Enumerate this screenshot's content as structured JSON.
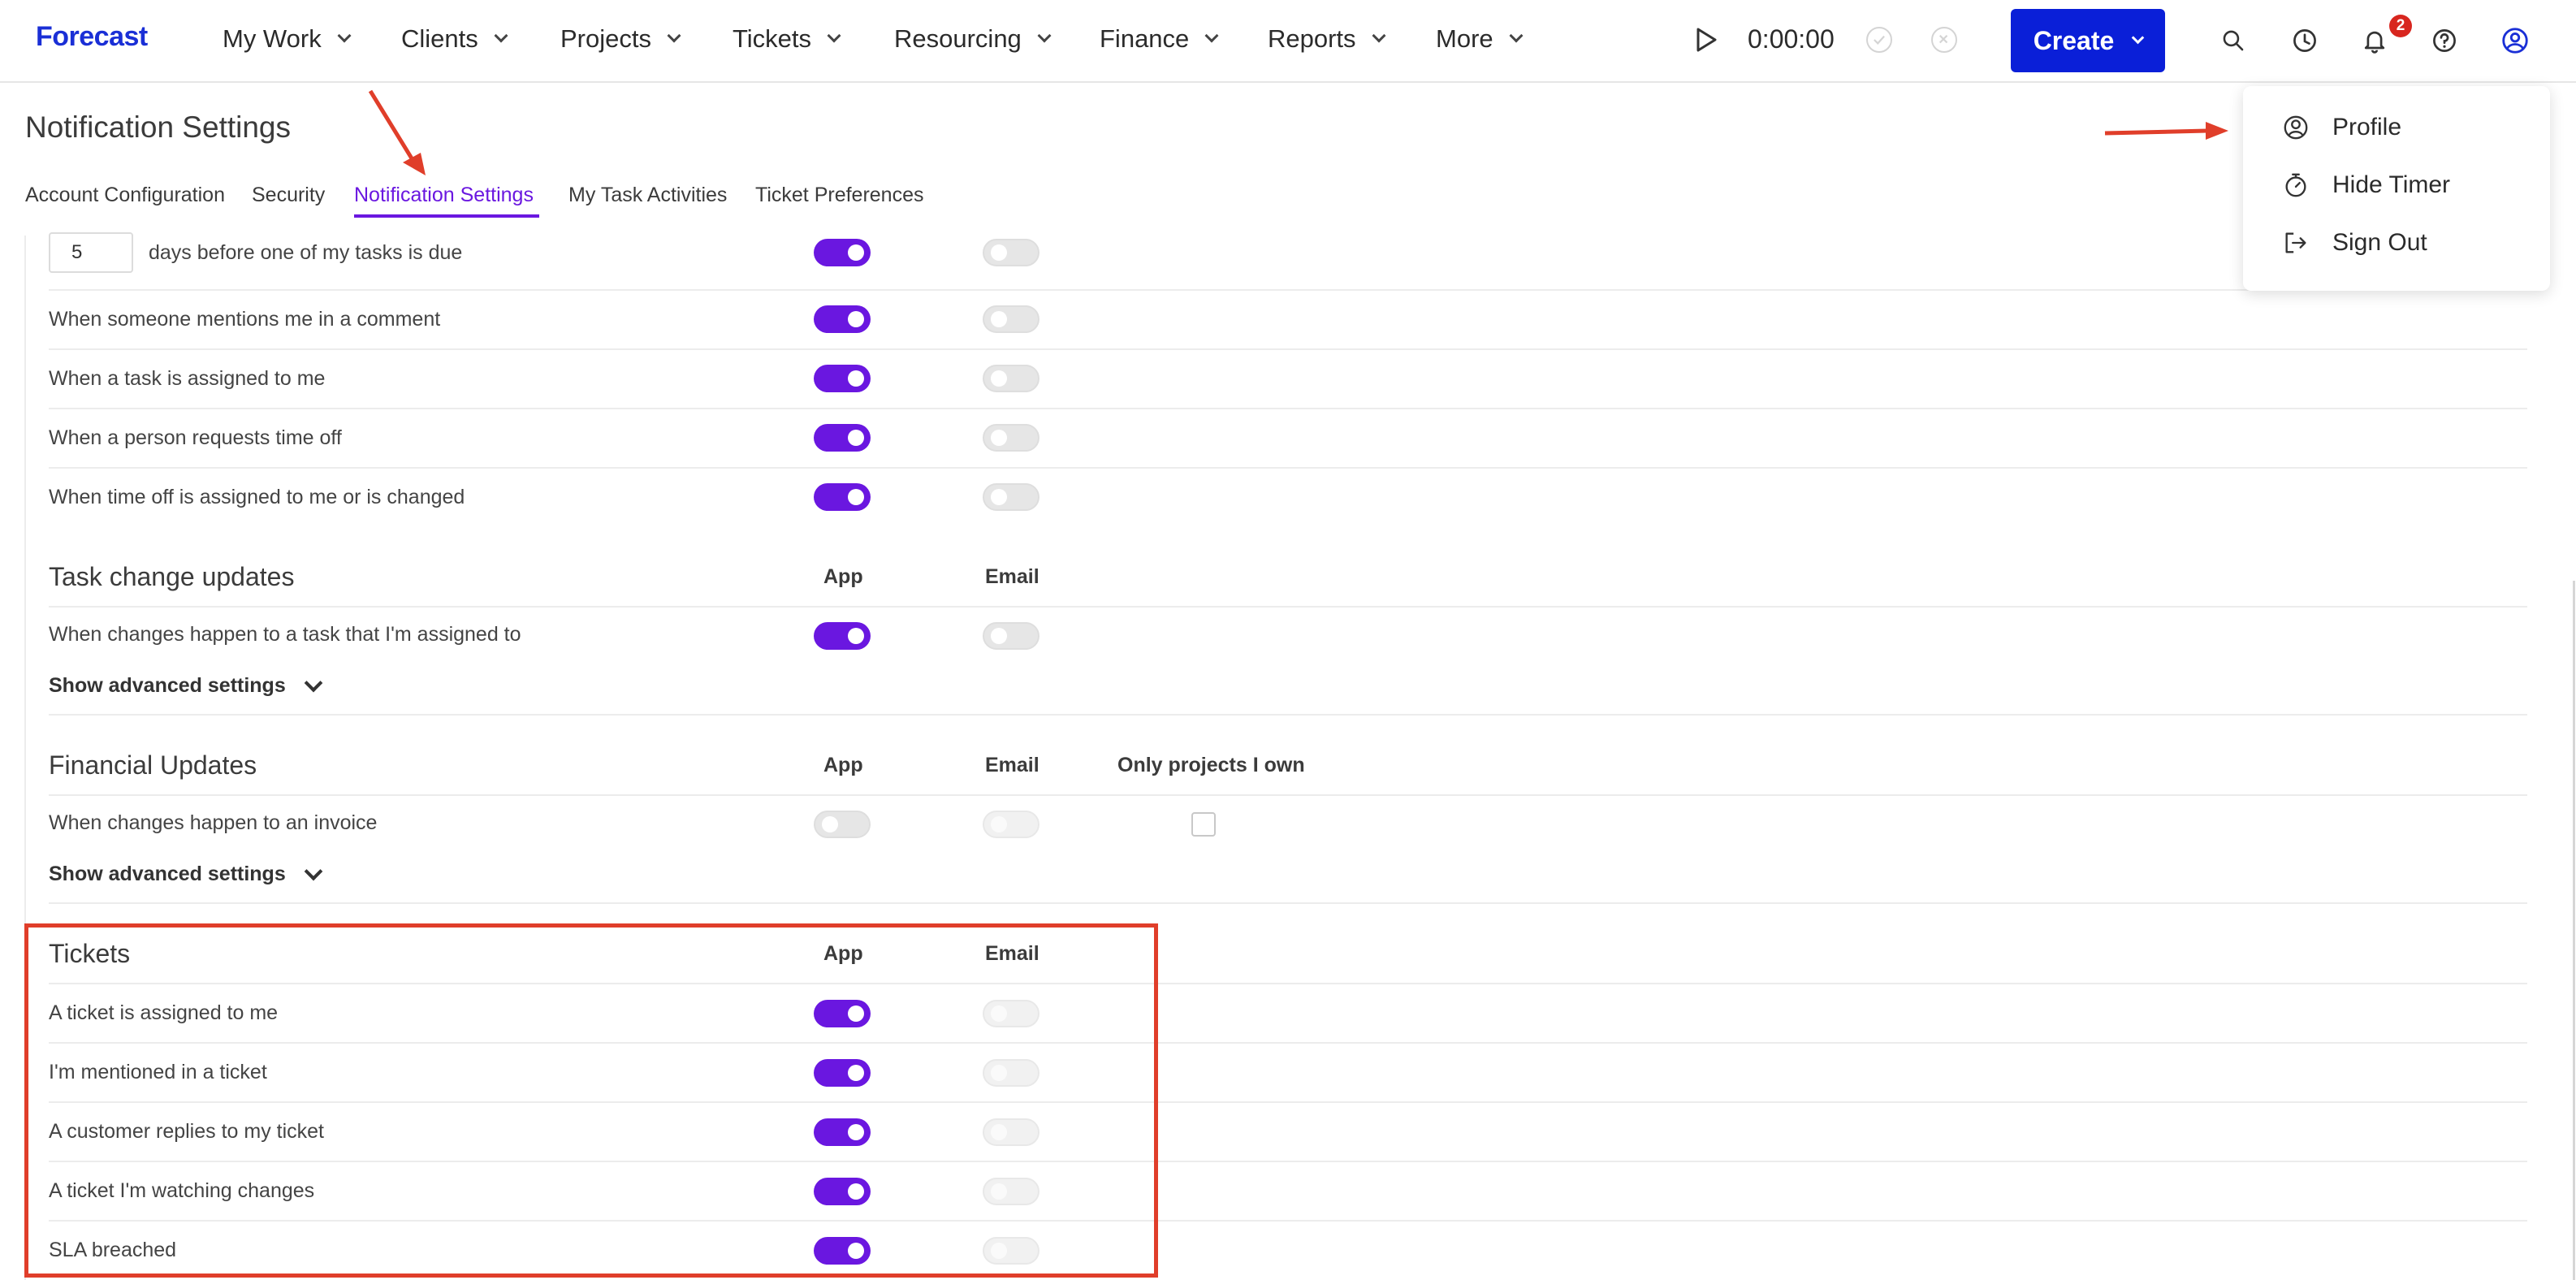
{
  "app": {
    "logo": "Forecast"
  },
  "nav": {
    "items": [
      {
        "label": "My Work"
      },
      {
        "label": "Clients"
      },
      {
        "label": "Projects"
      },
      {
        "label": "Tickets"
      },
      {
        "label": "Resourcing"
      },
      {
        "label": "Finance"
      },
      {
        "label": "Reports"
      },
      {
        "label": "More"
      }
    ],
    "timer": "0:00:00",
    "create_label": "Create",
    "notification_count": "2"
  },
  "page": {
    "title": "Notification Settings",
    "tabs": [
      {
        "label": "Account Configuration"
      },
      {
        "label": "Security"
      },
      {
        "label": "Notification Settings",
        "active": true
      },
      {
        "label": "My Task Activities"
      },
      {
        "label": "Ticket Preferences"
      }
    ]
  },
  "task_reminders": {
    "days_value": "5",
    "days_label": "days before one of my tasks is due",
    "rows": [
      {
        "label": "When someone mentions me in a comment",
        "app": true,
        "email": false
      },
      {
        "label": "When a task is assigned to me",
        "app": true,
        "email": false
      },
      {
        "label": "When a person requests time off",
        "app": true,
        "email": false
      },
      {
        "label": "When time off is assigned to me or is changed",
        "app": true,
        "email": false
      }
    ]
  },
  "task_change": {
    "title": "Task change updates",
    "col_app": "App",
    "col_email": "Email",
    "row": "When changes happen to a task that I'm assigned to",
    "advanced": "Show advanced settings"
  },
  "financial": {
    "title": "Financial Updates",
    "col_app": "App",
    "col_email": "Email",
    "col_own": "Only projects I own",
    "row": "When changes happen to an invoice",
    "advanced": "Show advanced settings"
  },
  "tickets": {
    "title": "Tickets",
    "col_app": "App",
    "col_email": "Email",
    "rows": [
      {
        "label": "A ticket is assigned to me"
      },
      {
        "label": "I'm mentioned in a ticket"
      },
      {
        "label": "A customer replies to my ticket"
      },
      {
        "label": "A ticket I'm watching changes"
      },
      {
        "label": "SLA breached"
      }
    ]
  },
  "profile_menu": {
    "items": [
      {
        "label": "Profile",
        "icon": "user-circle-icon"
      },
      {
        "label": "Hide Timer",
        "icon": "stopwatch-icon"
      },
      {
        "label": "Sign Out",
        "icon": "sign-out-icon"
      }
    ]
  },
  "colors": {
    "brand": "#0a1fd8",
    "accent": "#6a17e0",
    "annotation": "#e03e2a",
    "badge": "#d8261f"
  }
}
